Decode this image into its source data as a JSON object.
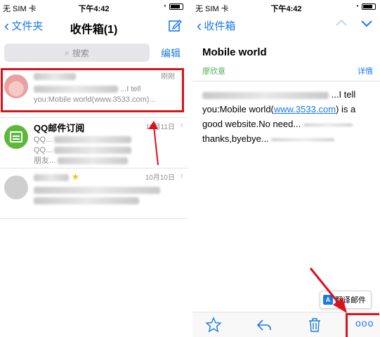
{
  "left": {
    "status": {
      "carrier": "无 SIM 卡",
      "time": "下午4:42"
    },
    "nav": {
      "back_label": "文件夹",
      "title": "收件箱(1)"
    },
    "search": {
      "placeholder": "搜索",
      "edit_label": "编辑"
    },
    "emails": [
      {
        "sender": "",
        "date": "刚刚",
        "preview_line1": "...I tell",
        "preview_line2": "you:Mobile world(www.3533.com)..."
      },
      {
        "sender": "QQ邮件订阅",
        "date": "12月11日",
        "preview_line1": "QQ...",
        "preview_line2": "QQ...",
        "preview_line3": "朋友..."
      },
      {
        "sender": "",
        "date": "10月10日"
      }
    ]
  },
  "right": {
    "status": {
      "carrier": "无 SIM 卡",
      "time": "下午4:42"
    },
    "nav": {
      "back_label": "收件箱"
    },
    "mail": {
      "subject": "Mobile world",
      "from": "廖欣意",
      "details_label": "详情",
      "body_line1": "...I tell",
      "body_line2_a": "you:Mobile world(",
      "body_link": "www.3533.com",
      "body_line2_b": ") is a",
      "body_line3": "good website.No need...",
      "body_line4": "thanks,byebye..."
    },
    "translate_label": "翻译邮件",
    "toolbar": {
      "more_label": "ooo"
    }
  },
  "colors": {
    "accent": "#1a7ae8",
    "highlight": "#d9121d",
    "from_green": "#4caf50"
  }
}
